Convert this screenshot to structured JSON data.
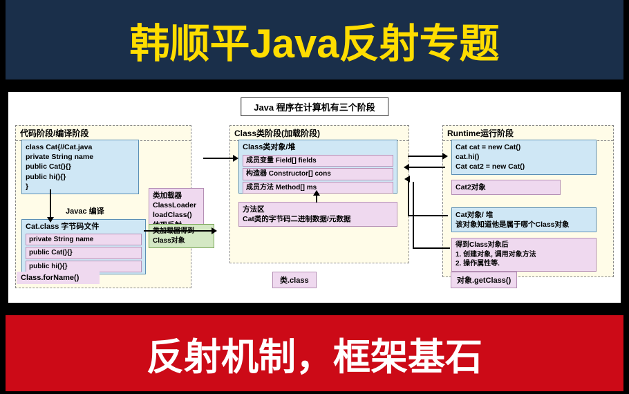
{
  "banner_top": "韩顺平Java反射专题",
  "banner_bottom": "反射机制，框架基石",
  "diagram_title": "Java 程序在计算机有三个阶段",
  "stage1": {
    "header": "代码阶段/编译阶段",
    "source_code": "class Cat{//Cat.java\nprivate String name\npublic Cat(){}\npublic hi(){}\n}",
    "compile_label": "Javac 编译",
    "loader": "类加载器\nClassLoader\nloadClass()\n体现反射",
    "loader_note": "类加载器得到Class对象",
    "catclass_header": "Cat.class 字节码文件",
    "catclass_items": [
      "private String name",
      "public Cat(){}",
      "public hi(){}"
    ],
    "forname": "Class.forName()"
  },
  "stage2": {
    "header": "Class类阶段(加载阶段)",
    "classobj_header": "Class类对象/堆",
    "classobj_items": [
      "成员变量 Field[] fields",
      "构造器 Constructor[] cons",
      "成员方法 Method[] ms"
    ],
    "methodarea": "方法区\nCat类的字节码二进制数据/元数据",
    "classlabel": "类.class"
  },
  "stage3": {
    "header": "Runtime运行阶段",
    "runtime1": "Cat cat = new Cat()\ncat.hi()\nCat cat2 = new Cat()",
    "runtime2": "Cat2对象",
    "runtime3": "Cat对象/ 堆\n该对象知道他是属于哪个Class对象",
    "runtime4": "得到Class对象后\n1. 创建对象, 调用对象方法\n2. 操作属性等.",
    "getclass": "对象.getClass()"
  }
}
